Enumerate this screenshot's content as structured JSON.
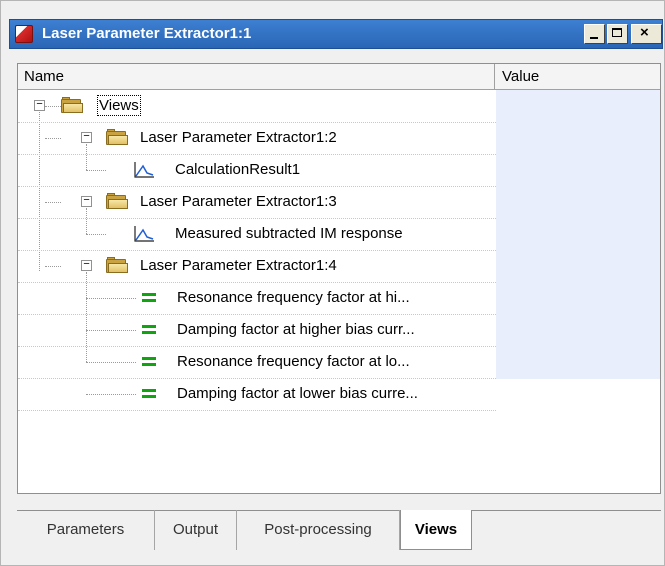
{
  "window": {
    "title": "Laser Parameter Extractor1:1",
    "close_glyph": "×"
  },
  "grid": {
    "columns": {
      "name": "Name",
      "value": "Value"
    },
    "rows": [
      {
        "label": "Views",
        "icon": "folder-icon"
      },
      {
        "label": "Laser Parameter Extractor1:2",
        "icon": "folder-icon"
      },
      {
        "label": "CalculationResult1",
        "icon": "graph-icon"
      },
      {
        "label": "Laser Parameter Extractor1:3",
        "icon": "folder-icon"
      },
      {
        "label": "Measured subtracted IM response",
        "icon": "graph-icon"
      },
      {
        "label": "Laser Parameter Extractor1:4",
        "icon": "folder-icon"
      },
      {
        "label": "Resonance frequency factor at hi...",
        "icon": "parameter-icon"
      },
      {
        "label": "Damping factor at higher bias curr...",
        "icon": "parameter-icon"
      },
      {
        "label": "Resonance frequency factor at lo...",
        "icon": "parameter-icon"
      },
      {
        "label": "Damping factor at lower bias curre...",
        "icon": "parameter-icon"
      }
    ],
    "expander_symbol": "−"
  },
  "tabs": [
    {
      "label": "Parameters"
    },
    {
      "label": "Output"
    },
    {
      "label": "Post-processing"
    },
    {
      "label": "Views",
      "selected": true
    }
  ],
  "colors": {
    "titlebar": "#2a66b6",
    "value_column": "#e8eefb",
    "parameter_icon": "#12a312",
    "folder": "#c9a241"
  }
}
